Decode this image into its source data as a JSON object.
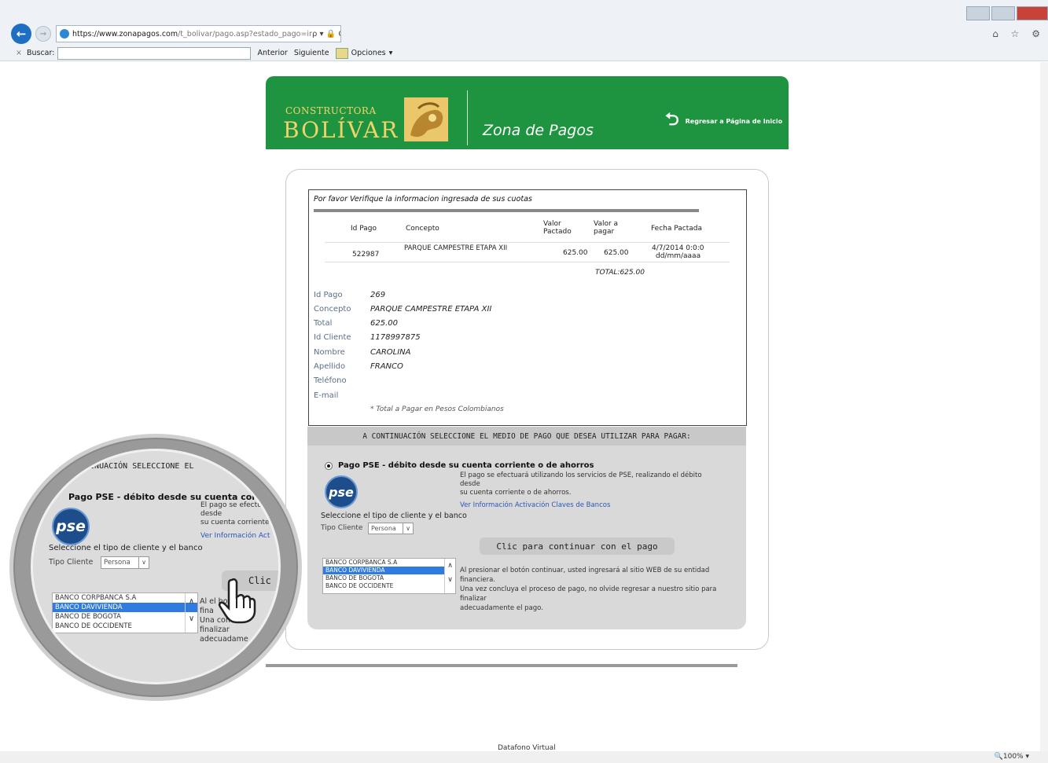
{
  "browser": {
    "url_host": "https://www.zonapagos.com",
    "url_path": "/t_bolivar/pago.asp?estado_pago=ir",
    "url_tools": "ρ ▾ 🔒 C",
    "find_close": "×",
    "find_label": "Buscar:",
    "find_prev": "Anterior",
    "find_next": "Siguiente",
    "find_options": "Opciones",
    "right_icons": "⌂ ☆ ⚙",
    "zoom": "🔍100%  ▾"
  },
  "header": {
    "brand_top": "CONSTRUCTORA",
    "brand_main": "BOLÍVAR",
    "zone": "Zona de Pagos",
    "return_link": "Regresar a Página de Inicio"
  },
  "verify": {
    "title": "Por favor Verifique la informacion ingresada de sus cuotas",
    "columns": [
      "Id Pago",
      "Concepto",
      "Valor Pactado",
      "Valor a pagar",
      "Fecha  Pactada"
    ],
    "row": {
      "id_pago": "522987",
      "concepto": "PARQUE CAMPESTRE ETAPA XII",
      "valor_pactado": "625.00",
      "valor_pagar": "625.00",
      "fecha": "4/7/2014 0:0:0",
      "fecha_fmt": "dd/mm/aaaa"
    },
    "total": "TOTAL:625.00"
  },
  "details": [
    {
      "label": "Id Pago",
      "value": "269"
    },
    {
      "label": "Concepto",
      "value": "PARQUE CAMPESTRE ETAPA XII"
    },
    {
      "label": "Total",
      "value": "625.00"
    },
    {
      "label": "Id Cliente",
      "value": "1178997875"
    },
    {
      "label": "Nombre",
      "value": "CAROLINA"
    },
    {
      "label": "Apellido",
      "value": "FRANCO"
    },
    {
      "label": "Teléfono",
      "value": ""
    },
    {
      "label": "E-mail",
      "value": ""
    }
  ],
  "note": "* Total a Pagar en Pesos Colombianos",
  "payment": {
    "header": "A CONTINUACIÓN SELECCIONE EL MEDIO DE PAGO QUE DESEA UTILIZAR PARA PAGAR:",
    "pse_title": "Pago PSE - débito desde su cuenta corriente o de ahorros",
    "pse_logo": "pse",
    "pse_desc_1": "El pago se efectuará utilizando los servicios de PSE, realizando el débito",
    "pse_desc_2": "desde",
    "pse_desc_3": "su cuenta corriente o de ahorros.",
    "pse_link": "Ver Información Activación Claves de Bancos",
    "select_text": "Seleccione el tipo de cliente y el banco",
    "tipo_label": "Tipo Cliente",
    "tipo_value": "Persona",
    "continue_button": "Clic para continuar con el pago",
    "banks": [
      "BANCO CORPBANCA S.A",
      "BANCO DAVIVIENDA",
      "BANCO DE BOGOTA",
      "BANCO DE OCCIDENTE"
    ],
    "selected_bank": "BANCO DAVIVIENDA",
    "info_1": "Al presionar el botón continuar, usted ingresará al sitio WEB de su entidad",
    "info_2": "financiera.",
    "info_3": "Una vez concluya el proceso de pago, no olvide regresar a nuestro sitio para",
    "info_4": "finalizar",
    "info_5": "adecuadamente el pago."
  },
  "magnifier": {
    "head": "NTINUACIÓN SELECCIONE EL",
    "pse_title": "Pago PSE - débito desde su cuenta corriente",
    "txt_1": "El pago se efectu",
    "txt_2": "desde",
    "txt_3": "su cuenta corriente",
    "link": "Ver Información Act",
    "select_text": "Seleccione el tipo de cliente y el banco",
    "tipo_label": "Tipo Cliente",
    "tipo_value": "Persona",
    "clic": "Clic pa",
    "banks": [
      "BANCO CORPBANCA S.A",
      "BANCO DAVIVIENDA",
      "BANCO DE BOGOTA",
      "BANCO DE OCCIDENTE"
    ],
    "rest_1": "Al        el bot",
    "rest_2": "fina",
    "rest_3": "Una      conclu",
    "rest_4": "finalizar",
    "rest_5": "adecuadame"
  },
  "footer": "Datafono Virtual"
}
